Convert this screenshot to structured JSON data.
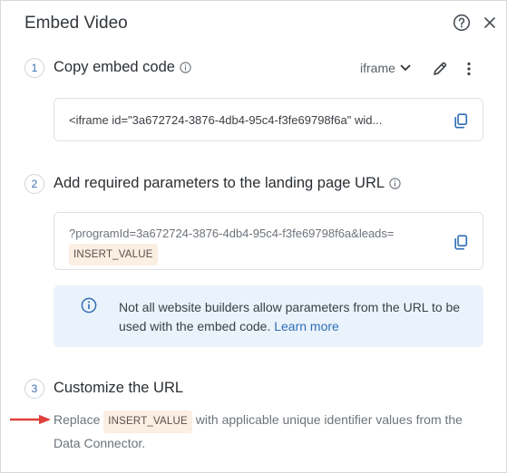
{
  "dialog": {
    "title": "Embed Video",
    "help_icon": "question-circle-icon",
    "close_icon": "close-icon"
  },
  "step1": {
    "number": "1",
    "title": "Copy embed code",
    "embed_type": "iframe",
    "code": "<iframe id=\"3a672724-3876-4db4-95c4-f3fe69798f6a\" wid..."
  },
  "step2": {
    "number": "2",
    "title": "Add required parameters to the landing page URL",
    "url": "?programId=3a672724-3876-4db4-95c4-f3fe69798f6a&leads=",
    "placeholder_token": "INSERT_VALUE",
    "notice_text": "Not all website builders allow parameters from the URL to be used with the embed code.",
    "learn_more": "Learn more"
  },
  "step3": {
    "number": "3",
    "title": "Customize the URL",
    "desc_before": "Replace",
    "token": "INSERT_VALUE",
    "desc_after": "with applicable unique identifier values from the Data Connector."
  },
  "colors": {
    "accent": "#2f6eb5",
    "arrow": "#e0403a",
    "notice_bg": "#eaf3fb",
    "token_bg": "#fbeee3"
  }
}
